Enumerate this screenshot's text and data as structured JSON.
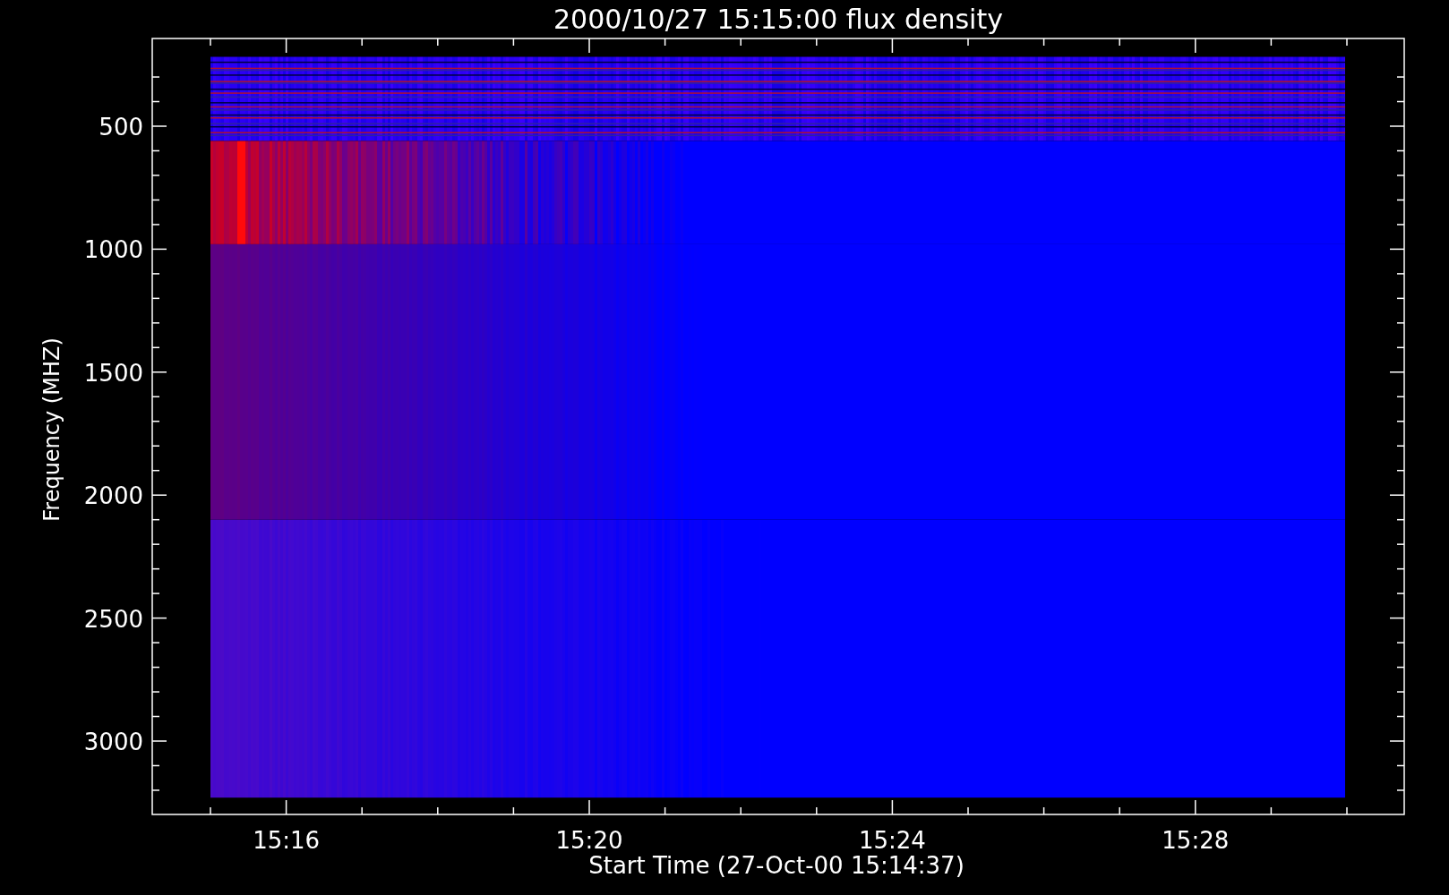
{
  "title": "2000/10/27 15:15:00 flux density",
  "y_axis": {
    "label": "Frequency (MHZ)",
    "ticks": [
      "500",
      "1000",
      "1500",
      "2000",
      "2500",
      "3000"
    ]
  },
  "x_axis": {
    "label": "Start Time (27-Oct-00 15:14:37)",
    "ticks": [
      "15:16",
      "15:20",
      "15:24",
      "15:28"
    ]
  }
}
